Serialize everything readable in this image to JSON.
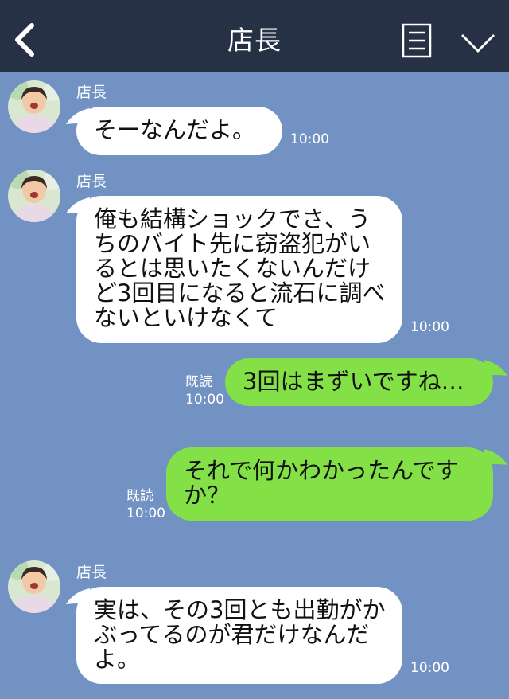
{
  "header": {
    "title": "店長"
  },
  "messages": [
    {
      "sender": "店長",
      "text": "そーなんだよ。",
      "time": "10:00"
    },
    {
      "sender": "店長",
      "text": "俺も結構ショックでさ、うちのバイト先に窃盗犯がいるとは思いたくないんだけど3回目になると流石に調べないといけなくて",
      "time": "10:00"
    },
    {
      "sender": "me",
      "text": "3回はまずいですね…",
      "read": "既読",
      "time": "10:00"
    },
    {
      "sender": "me",
      "text": "それで何かわかったんですか？",
      "read": "既読",
      "time": "10:00"
    },
    {
      "sender": "店長",
      "text": "実は、その3回とも出勤がかぶってるのが君だけなんだよ。",
      "time": "10:00"
    }
  ],
  "colors": {
    "header": "#263146",
    "background": "#7192c3",
    "my_bubble": "#83e046",
    "their_bubble": "#ffffff"
  },
  "icons": {
    "back": "chevron-left-icon",
    "menu": "menu-icon",
    "collapse": "chevron-down-icon",
    "avatar": "child-photo-avatar"
  }
}
